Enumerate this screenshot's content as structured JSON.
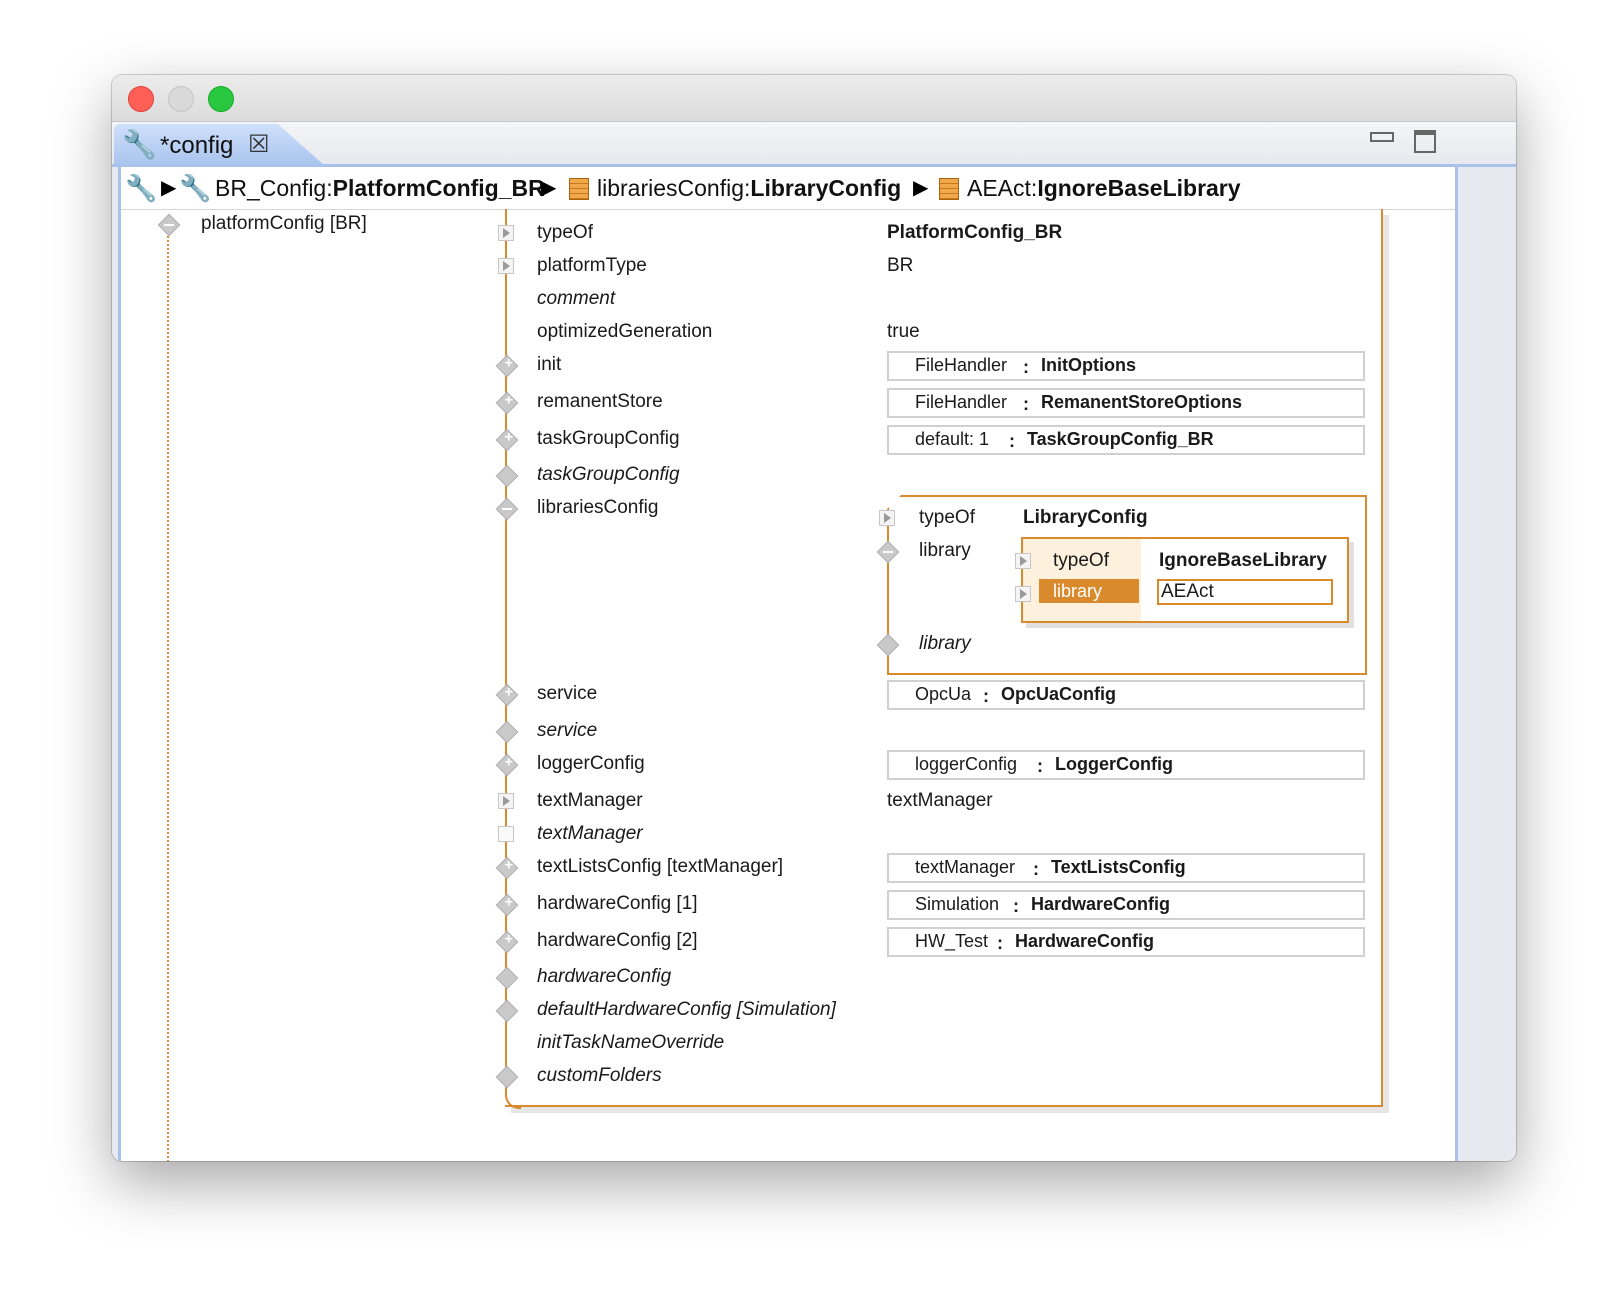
{
  "tab": {
    "label": "*config"
  },
  "breadcrumb": {
    "item1_name": "BR_Config:",
    "item1_type": "PlatformConfig_BR",
    "item2_name": "librariesConfig:",
    "item2_type": "LibraryConfig",
    "item3_name": "AEAct:",
    "item3_type": "IgnoreBaseLibrary"
  },
  "tree": {
    "root_label": "platformConfig [BR]"
  },
  "properties": {
    "typeOf": {
      "label": "typeOf",
      "value": "PlatformConfig_BR"
    },
    "platformType": {
      "label": "platformType",
      "value": "BR"
    },
    "comment": {
      "label": "comment"
    },
    "optimizedGeneration": {
      "label": "optimizedGeneration",
      "value": "true"
    },
    "init": {
      "label": "init",
      "ref_name": "FileHandler",
      "ref_type": "InitOptions"
    },
    "remanentStore": {
      "label": "remanentStore",
      "ref_name": "FileHandler",
      "ref_type": "RemanentStoreOptions"
    },
    "taskGroupConfig": {
      "label": "taskGroupConfig",
      "ref_name": "default: 1",
      "ref_type": "TaskGroupConfig_BR"
    },
    "taskGroupConfig_new": {
      "label": "taskGroupConfig"
    },
    "librariesConfig": {
      "label": "librariesConfig"
    },
    "service": {
      "label": "service",
      "ref_name": "OpcUa",
      "ref_type": "OpcUaConfig"
    },
    "service_new": {
      "label": "service"
    },
    "loggerConfig": {
      "label": "loggerConfig",
      "ref_name": "loggerConfig",
      "ref_type": "LoggerConfig"
    },
    "textManager": {
      "label": "textManager",
      "value": "textManager"
    },
    "textManager_new": {
      "label": "textManager"
    },
    "textListsConfig": {
      "label": "textListsConfig [textManager]",
      "ref_name": "textManager",
      "ref_type": "TextListsConfig"
    },
    "hardwareConfig1": {
      "label": "hardwareConfig [1]",
      "ref_name": "Simulation",
      "ref_type": "HardwareConfig"
    },
    "hardwareConfig2": {
      "label": "hardwareConfig [2]",
      "ref_name": "HW_Test",
      "ref_type": "HardwareConfig"
    },
    "hardwareConfig_new": {
      "label": "hardwareConfig"
    },
    "defaultHardwareConfig": {
      "label": "defaultHardwareConfig [Simulation]"
    },
    "initTaskNameOverride": {
      "label": "initTaskNameOverride"
    },
    "customFolders": {
      "label": "customFolders"
    }
  },
  "libraries": {
    "typeOf_label": "typeOf",
    "typeOf_value": "LibraryConfig",
    "library_label": "library",
    "library_new_label": "library",
    "inner": {
      "typeOf_label": "typeOf",
      "typeOf_value": "IgnoreBaseLibrary",
      "library_label": "library",
      "library_value": "AEAct"
    }
  },
  "colors": {
    "accent_orange": "#d98a2c",
    "tab_blue": "#a9c4ee"
  },
  "icons": [
    "wrench-icon",
    "close-icon",
    "minimize-icon",
    "maximize-icon",
    "chevron-right-icon",
    "class-box-icon"
  ]
}
